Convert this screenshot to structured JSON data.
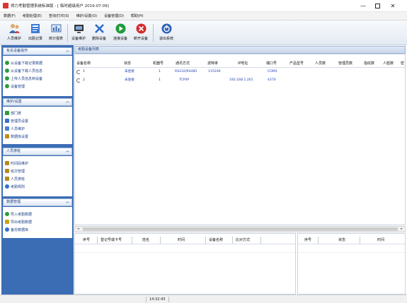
{
  "window": {
    "title": "得力考勤管理系统标准版 - [ 临时超级用户 2019-07-09]",
    "minimize": "—",
    "close": "✕"
  },
  "menu": [
    "数据(F)",
    "考勤处理(E)",
    "查询/打印(S)",
    "维护/设置(O)",
    "设备管理(D)",
    "帮助(H)"
  ],
  "toolbar": [
    {
      "label": "人员维护",
      "icon": "people-icon",
      "color": "#2f6db3"
    },
    {
      "label": "出勤记录",
      "icon": "record-book-icon",
      "color": "#3a7bd5"
    },
    {
      "label": "统计报表",
      "icon": "report-icon",
      "color": "#3f6fb0"
    },
    {
      "label": "设备维护",
      "icon": "device-icon",
      "color": "#333333"
    },
    {
      "label": "删除设备",
      "icon": "delete-x-icon",
      "color": "#2a6cc9"
    },
    {
      "label": "连接设备",
      "icon": "connect-play-icon",
      "color": "#1e9b3a"
    },
    {
      "label": "断开设备",
      "icon": "disconnect-icon",
      "color": "#d22b2b"
    },
    {
      "label": "退出系统",
      "icon": "exit-power-icon",
      "color": "#2a5fb8"
    }
  ],
  "sidebar": {
    "sections": [
      {
        "title": "有关设备操作",
        "items": [
          {
            "label": "从设备下载记录数据",
            "icon": "dot-icon",
            "color": "#2f9b3a"
          },
          {
            "label": "从设备下载人员信息",
            "icon": "dot-icon",
            "color": "#2f9b3a"
          },
          {
            "label": "上传人员信息到设备",
            "icon": "dot-icon",
            "color": "#2f9b3a"
          },
          {
            "label": "设备管理",
            "icon": "dot-icon",
            "color": "#2f9b3a"
          }
        ]
      },
      {
        "title": "维护/设置",
        "items": [
          {
            "label": "部门表",
            "icon": "dept-icon",
            "color": "#2f9b3a"
          },
          {
            "label": "管理员设置",
            "icon": "admin-icon",
            "color": "#3a6fc4"
          },
          {
            "label": "人员维护",
            "icon": "person-icon",
            "color": "#4a7fc9"
          },
          {
            "label": "数据库设置",
            "icon": "database-icon",
            "color": "#c08a1a"
          }
        ]
      },
      {
        "title": "人员排班",
        "items": [
          {
            "label": "时间段维护",
            "icon": "clock-icon",
            "color": "#b38a20"
          },
          {
            "label": "班次管理",
            "icon": "shift-icon",
            "color": "#b38a20"
          },
          {
            "label": "人员排班",
            "icon": "schedule-icon",
            "color": "#b38a20"
          },
          {
            "label": "考勤规则",
            "icon": "rule-icon",
            "color": "#2f6fd0"
          }
        ]
      },
      {
        "title": "数据管理",
        "items": [
          {
            "label": "导入考勤数据",
            "icon": "import-icon",
            "color": "#2f9b3a"
          },
          {
            "label": "导出考勤数据",
            "icon": "export-icon",
            "color": "#c6a21a"
          },
          {
            "label": "备份数据库",
            "icon": "backup-icon",
            "color": "#2f6fd0"
          }
        ]
      }
    ],
    "chevron": "︽"
  },
  "main": {
    "title": "考勤设备列表",
    "columns": [
      "设备名称",
      "状态",
      "机器号",
      "通讯方式",
      "波特率",
      "IP地址",
      "端口号",
      "产品型号",
      "人员数",
      "管理员数",
      "指纹数",
      "人脸数",
      "密"
    ],
    "rows": [
      {
        "id": "1",
        "status": "未连接",
        "machine": "1",
        "comm": "RS232/RS485",
        "baud": "115200",
        "ip": "",
        "port": "COM1"
      },
      {
        "id": "2",
        "status": "未连接",
        "machine": "1",
        "comm": "TCP/IP",
        "baud": "",
        "ip": "192.168.1.201",
        "port": "4370"
      }
    ],
    "log_columns": [
      "序号",
      "登记号或卡号",
      "姓名",
      "时间",
      "设备名称",
      "比对方式"
    ],
    "event_columns": [
      "序号",
      "状态",
      "时间"
    ]
  },
  "status": {
    "time": "14:32:43"
  }
}
